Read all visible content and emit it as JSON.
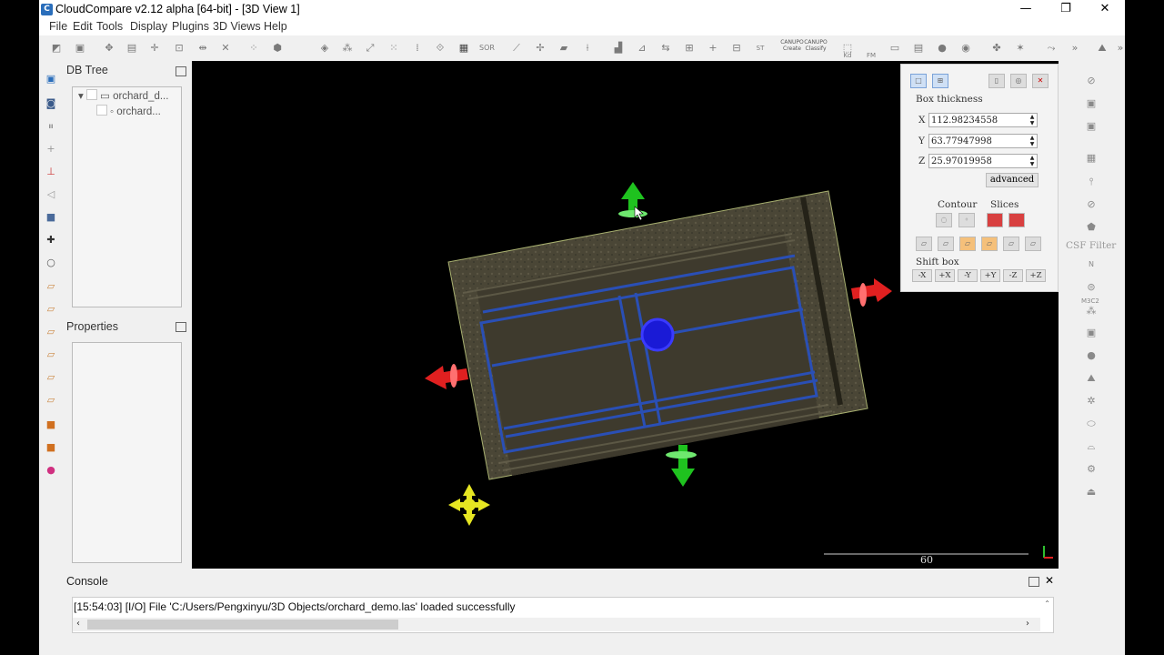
{
  "window": {
    "title": "CloudCompare v2.12 alpha [64-bit] - [3D View 1]",
    "minimize": "—",
    "maximize": "❐",
    "close": "✕"
  },
  "menu": [
    "File",
    "Edit",
    "Tools",
    "Display",
    "Plugins",
    "3D Views",
    "Help"
  ],
  "toolbar": {
    "sor_label": "SOR",
    "canupo_create": "CANUPO Create",
    "canupo_classify": "CANUPO Classify",
    "kd_label": "Kd",
    "fm_label": "FM"
  },
  "db_tree": {
    "title": "DB Tree",
    "items": [
      "orchard_d...",
      "orchard..."
    ]
  },
  "properties": {
    "title": "Properties"
  },
  "interactive_box": {
    "section_title": "Box thickness",
    "x_label": "X",
    "x_value": "112.98234558",
    "y_label": "Y",
    "y_value": "63.77947998",
    "z_label": "Z",
    "z_value": "25.97019958",
    "advanced_label": "advanced",
    "contour_label": "Contour",
    "slices_label": "Slices",
    "shift_title": "Shift box",
    "shift_buttons": [
      "-X",
      "+X",
      "-Y",
      "+Y",
      "-Z",
      "+Z"
    ]
  },
  "right_panel": {
    "csf_filter": "CSF Filter",
    "m3c2": "M3C2"
  },
  "view": {
    "scale_value": "60"
  },
  "console": {
    "title": "Console",
    "line": "[15:54:03] [I/O] File 'C:/Users/Pengxinyu/3D Objects/orchard_demo.las' loaded successfully"
  },
  "colors": {
    "view_bg": "#000000",
    "move_x": "#e02020",
    "move_y": "#1fc21f",
    "center": "#1a1ad6",
    "rotate": "#e6e622",
    "accent": "#2a6ebb"
  }
}
